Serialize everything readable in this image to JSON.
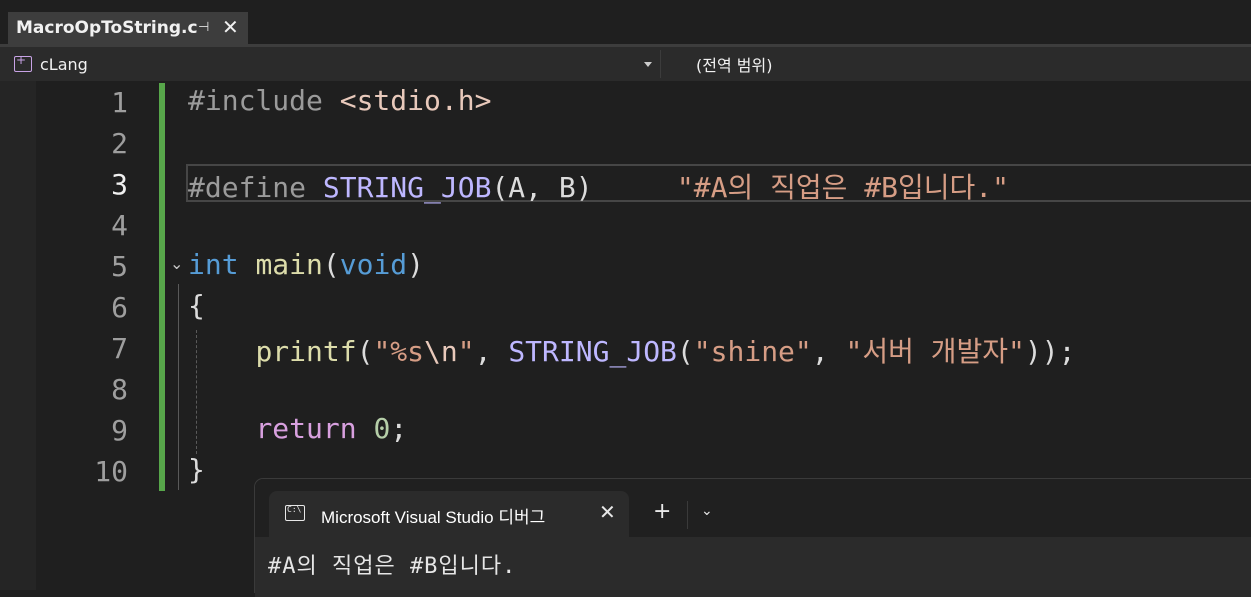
{
  "tab": {
    "title": "MacroOpToString.c",
    "pin": "⊣",
    "close": "✕"
  },
  "navbar": {
    "project": "cLang",
    "scope": "(전역 범위)"
  },
  "editor": {
    "line_numbers": [
      "1",
      "2",
      "3",
      "4",
      "5",
      "6",
      "7",
      "8",
      "9",
      "10"
    ],
    "current_line": "3",
    "line1": {
      "directive": "#include",
      "header": "<stdio.h>"
    },
    "line3": {
      "directive": "#define",
      "macro_name": "STRING_JOB",
      "params": "(A, B)",
      "body": "\"#A의 직업은 #B입니다.\""
    },
    "line5": {
      "type": "int",
      "fn": "main",
      "open": "(",
      "param": "void",
      "close": ")"
    },
    "line6": "{",
    "line7": {
      "fn": "printf",
      "open": "(",
      "fmt_open": "\"%s",
      "escape": "\\n",
      "fmt_close": "\"",
      "comma": ", ",
      "macro": "STRING_JOB",
      "arg_open": "(",
      "arg1": "\"shine\"",
      "arg_comma": ", ",
      "arg2": "\"서버 개발자\"",
      "tail": "));"
    },
    "line9": {
      "keyword": "return",
      "value": "0",
      "semi": ";"
    },
    "line10": "}"
  },
  "console": {
    "title": "Microsoft Visual Studio 디버그",
    "close": "✕",
    "plus": "+",
    "dropdown": "⌄",
    "output": "#A의 직업은 #B입니다."
  }
}
